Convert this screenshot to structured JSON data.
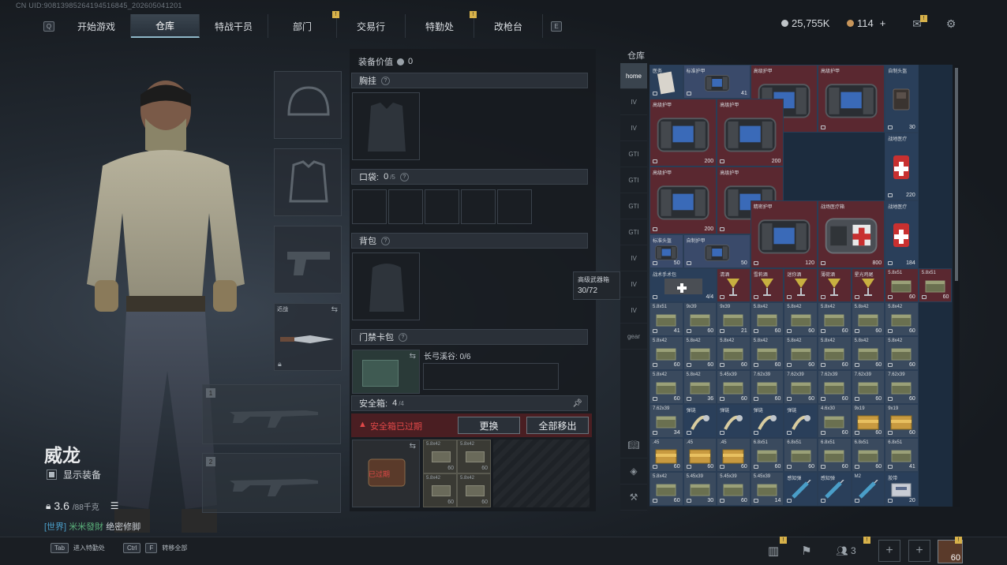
{
  "uid": "CN UID:9081398526419451684​5_202605041201",
  "topnav": {
    "left_key": "Q",
    "right_key": "E",
    "tabs": [
      {
        "label": "开始游戏"
      },
      {
        "label": "仓库",
        "active": true
      },
      {
        "label": "特战干员"
      },
      {
        "label": "部门",
        "badge": "!"
      },
      {
        "label": "交易行"
      },
      {
        "label": "特勤处",
        "badge": "!"
      },
      {
        "label": "改枪台"
      }
    ]
  },
  "currency": {
    "silver": "25,755K",
    "gold": "114",
    "plus": "+"
  },
  "operator": {
    "name": "威龙",
    "show_equipment": "显示装备",
    "weight": "3.6",
    "weight_max": "/88千克",
    "chat_channel": "[世界]",
    "chat_user": "米米發財",
    "chat_msg": "绝密修脚"
  },
  "melee": {
    "label": "近战"
  },
  "weapon_slots": [
    {
      "num": "1"
    },
    {
      "num": "2"
    }
  ],
  "mid": {
    "equip_value_label": "装备价值",
    "equip_value": "0",
    "chest": "胸挂",
    "pocket_label": "口袋:",
    "pocket_count": "0",
    "pocket_max": "/5",
    "backpack": "背包",
    "keycard": "门禁卡包",
    "keycard_area": "长弓溪谷: 0/6",
    "safe_label": "安全箱:",
    "safe_count": "4",
    "safe_max": "/4",
    "safe_expired": "安全箱已过期",
    "btn_change": "更换",
    "btn_move_all": "全部移出",
    "expired_tag": "已过期"
  },
  "safe_items": [
    {
      "n": "5.8x42",
      "c": "60"
    },
    {
      "n": "5.8x42",
      "c": "60"
    },
    {
      "n": "5.8x42",
      "c": "60"
    },
    {
      "n": "5.8x42",
      "c": "60"
    }
  ],
  "warehouse": {
    "title": "仓库",
    "tooltip_title": "高级武器箱",
    "tooltip_value": "30/72"
  },
  "sidebar": [
    {
      "label": "home"
    },
    {
      "label": "IV"
    },
    {
      "label": "IV"
    },
    {
      "label": "GTI"
    },
    {
      "label": "GTI"
    },
    {
      "label": "GTI"
    },
    {
      "label": "GTI"
    },
    {
      "label": "IV"
    },
    {
      "label": "IV"
    },
    {
      "label": "IV"
    },
    {
      "label": "gear"
    }
  ],
  "sidebar_bottom": [
    "book",
    "layers",
    "tool"
  ],
  "grid_items": [
    {
      "n": "医务",
      "c": "",
      "bg": "#2a3f5a",
      "kind": "card"
    },
    {
      "n": "标准护甲",
      "c": "41",
      "bg": "#3a4a6a",
      "kind": "armor",
      "w": 2
    },
    {
      "n": "高级护甲",
      "c": "",
      "bg": "#5a2830",
      "kind": "armor_big",
      "w": 2,
      "h": 2
    },
    {
      "n": "高级护甲",
      "c": "",
      "bg": "#5a2830",
      "kind": "armor_big",
      "w": 2,
      "h": 2
    },
    {
      "n": "自制头盔",
      "c": "30",
      "bg": "#2a3f5a",
      "kind": "helmet"
    },
    {
      "n": "高级护甲",
      "c": "200",
      "bg": "#5a2830",
      "kind": "armor_big",
      "w": 2,
      "h": 2
    },
    {
      "n": "高级护甲",
      "c": "200",
      "bg": "#5a2830",
      "kind": "armor_big",
      "w": 2,
      "h": 2
    },
    {
      "n": "战地医疗",
      "c": "220",
      "bg": "#2a3f5a",
      "kind": "medkit"
    },
    {
      "n": "高级护甲",
      "c": "200",
      "bg": "#5a2830",
      "kind": "armor_big",
      "w": 2,
      "h": 2
    },
    {
      "n": "高级护甲",
      "c": "200",
      "bg": "#5a2830",
      "kind": "armor_big",
      "w": 2,
      "h": 2
    },
    {
      "n": "战地医疗",
      "c": "184",
      "bg": "#2a3f5a",
      "kind": "medkit"
    },
    {
      "n": "标准头盔",
      "c": "50",
      "bg": "#3a4a6a",
      "kind": "armor"
    },
    {
      "n": "自制护甲",
      "c": "50",
      "bg": "#3a4a6a",
      "kind": "armor"
    },
    {
      "n": "精密护甲",
      "c": "120",
      "bg": "#5a2830",
      "kind": "armor_big",
      "w": 2,
      "h": 2
    },
    {
      "n": "战场医疗箱",
      "c": "800",
      "bg": "#5a2830",
      "kind": "medbag",
      "w": 2,
      "h": 2
    }
  ],
  "ammo_rows": [
    [
      {
        "n": "战术手术包",
        "c": "4/4",
        "kind": "kit"
      },
      {
        "n": "清酒",
        "c": "",
        "kind": "cocktail"
      },
      {
        "n": "雪莉酒",
        "c": "",
        "kind": "cocktail"
      },
      {
        "n": "迷你酒",
        "c": "",
        "kind": "cocktail"
      },
      {
        "n": "薄荷酒",
        "c": "",
        "kind": "cocktail"
      },
      {
        "n": "星光鸡尾",
        "c": "",
        "kind": "cocktail"
      },
      {
        "n": "5.8x51",
        "c": "60",
        "kind": "ammo"
      },
      {
        "n": "5.8x51",
        "c": "60",
        "kind": "ammo"
      }
    ],
    [
      {
        "n": "5.8x51",
        "c": "41",
        "kind": "ammo"
      },
      {
        "n": "9x39",
        "c": "60",
        "kind": "ammo"
      },
      {
        "n": "9x39",
        "c": "21",
        "kind": "ammo"
      },
      {
        "n": "5.8x42",
        "c": "60",
        "kind": "ammo"
      },
      {
        "n": "5.8x42",
        "c": "60",
        "kind": "ammo"
      },
      {
        "n": "5.8x42",
        "c": "60",
        "kind": "ammo"
      },
      {
        "n": "5.8x42",
        "c": "60",
        "kind": "ammo"
      },
      {
        "n": "5.8x42",
        "c": "60",
        "kind": "ammo"
      }
    ],
    [
      {
        "n": "5.8x42",
        "c": "60",
        "kind": "ammo"
      },
      {
        "n": "5.8x42",
        "c": "60",
        "kind": "ammo"
      },
      {
        "n": "5.8x42",
        "c": "60",
        "kind": "ammo"
      },
      {
        "n": "5.8x42",
        "c": "60",
        "kind": "ammo"
      },
      {
        "n": "5.8x42",
        "c": "60",
        "kind": "ammo"
      },
      {
        "n": "5.8x42",
        "c": "60",
        "kind": "ammo"
      },
      {
        "n": "5.8x42",
        "c": "60",
        "kind": "ammo"
      },
      {
        "n": "5.8x42",
        "c": "60",
        "kind": "ammo"
      }
    ],
    [
      {
        "n": "5.8x42",
        "c": "60",
        "kind": "ammo"
      },
      {
        "n": "5.8x42",
        "c": "36",
        "kind": "ammo"
      },
      {
        "n": "5.45x39",
        "c": "60",
        "kind": "ammo"
      },
      {
        "n": "7.62x39",
        "c": "60",
        "kind": "ammo"
      },
      {
        "n": "7.62x39",
        "c": "60",
        "kind": "ammo"
      },
      {
        "n": "7.62x39",
        "c": "60",
        "kind": "ammo"
      },
      {
        "n": "7.62x39",
        "c": "60",
        "kind": "ammo"
      },
      {
        "n": "7.62x39",
        "c": "60",
        "kind": "ammo"
      }
    ],
    [
      {
        "n": "7.62x39",
        "c": "34",
        "kind": "ammo"
      },
      {
        "n": "弹链",
        "c": "",
        "kind": "belt"
      },
      {
        "n": "弹链",
        "c": "",
        "kind": "belt"
      },
      {
        "n": "弹链",
        "c": "",
        "kind": "belt"
      },
      {
        "n": "弹链",
        "c": "",
        "kind": "belt"
      },
      {
        "n": "4.6x30",
        "c": "60",
        "kind": "ammo"
      },
      {
        "n": "9x19",
        "c": "60",
        "kind": "crate"
      },
      {
        "n": "9x19",
        "c": "60",
        "kind": "crate"
      }
    ],
    [
      {
        "n": ".45",
        "c": "60",
        "kind": "crate"
      },
      {
        "n": ".45",
        "c": "60",
        "kind": "crate"
      },
      {
        "n": ".45",
        "c": "60",
        "kind": "crate"
      },
      {
        "n": "6.8x51",
        "c": "60",
        "kind": "ammo"
      },
      {
        "n": "6.8x51",
        "c": "60",
        "kind": "ammo"
      },
      {
        "n": "6.8x51",
        "c": "60",
        "kind": "ammo"
      },
      {
        "n": "6.8x51",
        "c": "60",
        "kind": "ammo"
      },
      {
        "n": "6.8x51",
        "c": "41",
        "kind": "ammo"
      }
    ],
    [
      {
        "n": "5.8x42",
        "c": "60",
        "kind": "ammo"
      },
      {
        "n": "5.45x39",
        "c": "30",
        "kind": "ammo"
      },
      {
        "n": "5.45x39",
        "c": "60",
        "kind": "ammo"
      },
      {
        "n": "5.45x39",
        "c": "14",
        "kind": "ammo"
      },
      {
        "n": "感知弹",
        "c": "",
        "kind": "syringe"
      },
      {
        "n": "感知弹",
        "c": "",
        "kind": "syringe"
      },
      {
        "n": "M2",
        "c": "",
        "kind": "syringe"
      },
      {
        "n": "胶带",
        "c": "20",
        "kind": "tape"
      }
    ]
  ],
  "bottom": {
    "hint1_key": "Tab",
    "hint1": "进入特勤处",
    "hint2_key1": "Ctrl",
    "hint2_key2": "F",
    "hint2": "转移全部",
    "team_count": "3",
    "level": "60"
  },
  "colors": {
    "accent": "#8fb8c9",
    "badge": "#d8b24a",
    "danger": "#e04848",
    "red_slot": "#5a2830",
    "blue_slot": "#2a3f5a"
  }
}
